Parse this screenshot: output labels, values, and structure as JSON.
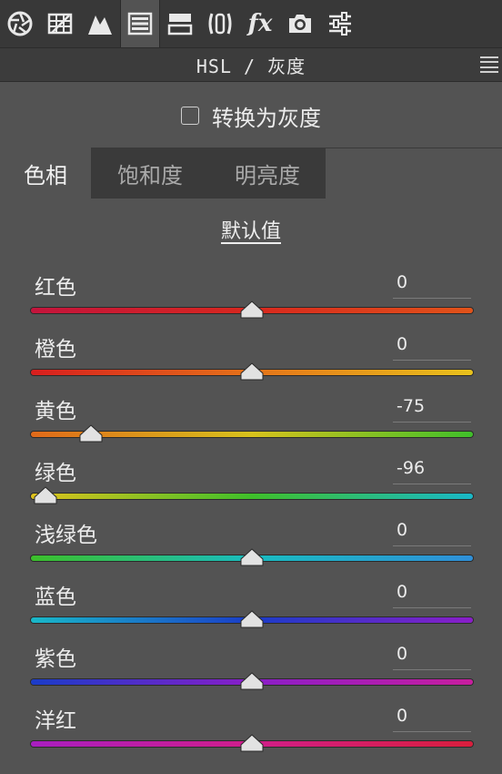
{
  "toolbar": {
    "tools": [
      {
        "icon": "aperture-icon"
      },
      {
        "icon": "grid-icon"
      },
      {
        "icon": "mountain-icon"
      },
      {
        "icon": "hsl-icon",
        "active": true
      },
      {
        "icon": "split-toning-icon"
      },
      {
        "icon": "lens-icon"
      },
      {
        "icon": "fx-icon",
        "label": "fx"
      },
      {
        "icon": "camera-icon"
      },
      {
        "icon": "sliders-icon"
      }
    ]
  },
  "panel": {
    "title": "HSL / 灰度"
  },
  "grayscale": {
    "label": "转换为灰度",
    "checked": false
  },
  "tabs": [
    {
      "label": "色相",
      "active": true
    },
    {
      "label": "饱和度",
      "active": false
    },
    {
      "label": "明亮度",
      "active": false
    }
  ],
  "default_link": "默认值",
  "sliders": [
    {
      "label": "红色",
      "value": "0",
      "num": 0,
      "gradient": [
        "#c4143c",
        "#d8281e",
        "#e1531a"
      ]
    },
    {
      "label": "橙色",
      "value": "0",
      "num": 0,
      "gradient": [
        "#d81e1e",
        "#e5731a",
        "#e8c21c"
      ]
    },
    {
      "label": "黄色",
      "value": "-75",
      "num": -75,
      "gradient": [
        "#e0691a",
        "#d8c21c",
        "#3fbf2a"
      ]
    },
    {
      "label": "绿色",
      "value": "-96",
      "num": -96,
      "gradient": [
        "#e0c21c",
        "#3fbf2a",
        "#19b8c8"
      ]
    },
    {
      "label": "浅绿色",
      "value": "0",
      "num": 0,
      "gradient": [
        "#3cbf2a",
        "#19bcc0",
        "#2f8fd8"
      ]
    },
    {
      "label": "蓝色",
      "value": "0",
      "num": 0,
      "gradient": [
        "#19b8c8",
        "#1a3cc8",
        "#8a1ec8"
      ]
    },
    {
      "label": "紫色",
      "value": "0",
      "num": 0,
      "gradient": [
        "#1a3cc8",
        "#8a1ec8",
        "#c81e9e"
      ]
    },
    {
      "label": "洋红",
      "value": "0",
      "num": 0,
      "gradient": [
        "#a81ec0",
        "#d01e8a",
        "#d81e3c"
      ]
    }
  ]
}
